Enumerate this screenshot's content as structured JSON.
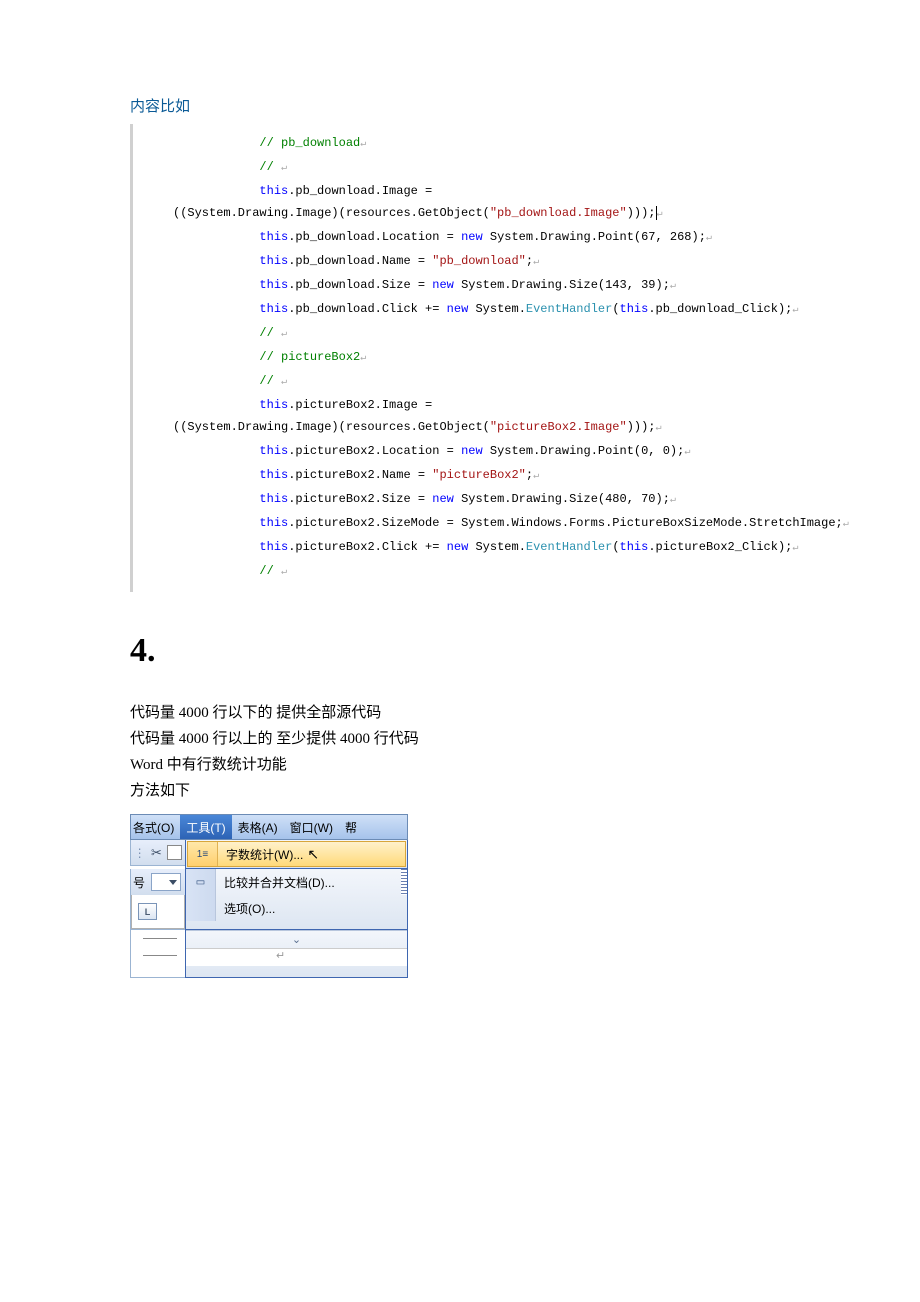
{
  "intro_label": "内容比如",
  "code": {
    "l1": "// pb_download",
    "l2": "// ",
    "l3a": "this",
    "l3b": ".pb_download.Image =",
    "l4a": "((System.Drawing.Image)(resources.GetObject(",
    "l4b": "\"pb_download.Image\"",
    "l4c": ")));",
    "l5a": "this",
    "l5b": ".pb_download.Location = ",
    "l5c": "new",
    "l5d": " System.Drawing.Point(67, 268);",
    "l6a": "this",
    "l6b": ".pb_download.Name = ",
    "l6c": "\"pb_download\"",
    "l6d": ";",
    "l7a": "this",
    "l7b": ".pb_download.Size = ",
    "l7c": "new",
    "l7d": " System.Drawing.Size(143, 39);",
    "l8a": "this",
    "l8b": ".pb_download.Click += ",
    "l8c": "new",
    "l8d": " System.",
    "l8e": "EventHandler",
    "l8f": "(",
    "l8g": "this",
    "l8h": ".pb_download_Click);",
    "l9": "// ",
    "l10": "// pictureBox2",
    "l11": "// ",
    "l12a": "this",
    "l12b": ".pictureBox2.Image =",
    "l13a": "((System.Drawing.Image)(resources.GetObject(",
    "l13b": "\"pictureBox2.Image\"",
    "l13c": ")));",
    "l14a": "this",
    "l14b": ".pictureBox2.Location = ",
    "l14c": "new",
    "l14d": " System.Drawing.Point(0, 0);",
    "l15a": "this",
    "l15b": ".pictureBox2.Name = ",
    "l15c": "\"pictureBox2\"",
    "l15d": ";",
    "l16a": "this",
    "l16b": ".pictureBox2.Size = ",
    "l16c": "new",
    "l16d": " System.Drawing.Size(480, 70);",
    "l17a": "this",
    "l17b": ".pictureBox2.SizeMode = System.Windows.Forms.PictureBoxSizeMode.StretchImage;",
    "l18a": "this",
    "l18b": ".pictureBox2.Click += ",
    "l18c": "new",
    "l18d": " System.",
    "l18e": "EventHandler",
    "l18f": "(",
    "l18g": "this",
    "l18h": ".pictureBox2_Click);",
    "l19": "// "
  },
  "ret": "↵",
  "section_num": "4.",
  "para": {
    "p1": "代码量 4000 行以下的 提供全部源代码",
    "p2": "代码量 4000 行以上的 至少提供 4000 行代码",
    "p3": "Word 中有行数统计功能",
    "p4": "方法如下"
  },
  "word": {
    "menu_format_partial": "各式(O)",
    "menu_tools": "工具(T)",
    "menu_table": "表格(A)",
    "menu_window": "窗口(W)",
    "menu_help_partial": "帮",
    "dd_wordcount": "字数统计(W)...",
    "dd_compare": "比较并合并文档(D)...",
    "dd_options": "选项(O)...",
    "side_label": "号",
    "ruler_L": "L",
    "chevron": "⌄",
    "cursor_glyph": "↖",
    "return_glyph": "↵"
  }
}
